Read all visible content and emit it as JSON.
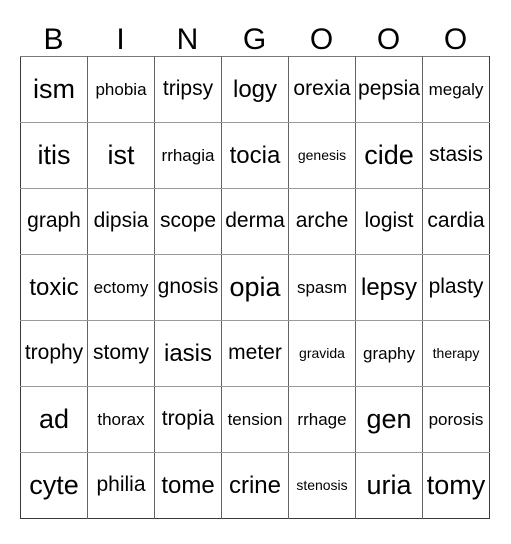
{
  "card": {
    "title_letters": [
      "B",
      "I",
      "N",
      "G",
      "O",
      "O",
      "O"
    ],
    "columns": 7,
    "rows": 7,
    "colors": {
      "background": "#ffffff",
      "text": "#000000",
      "vertical_border": "#636363",
      "horizontal_border": "#9a9a9a",
      "outer_border": "#3a3a3a"
    },
    "grid": [
      [
        {
          "text": "ism",
          "size": "sz-xl"
        },
        {
          "text": "phobia",
          "size": "sz-sm"
        },
        {
          "text": "tripsy",
          "size": "sz-md"
        },
        {
          "text": "logy",
          "size": "sz-lg"
        },
        {
          "text": "orexia",
          "size": "sz-md"
        },
        {
          "text": "pepsia",
          "size": "sz-md"
        },
        {
          "text": "megaly",
          "size": "sz-sm"
        }
      ],
      [
        {
          "text": "itis",
          "size": "sz-xl"
        },
        {
          "text": "ist",
          "size": "sz-xl"
        },
        {
          "text": "rrhagia",
          "size": "sz-sm"
        },
        {
          "text": "tocia",
          "size": "sz-lg"
        },
        {
          "text": "genesis",
          "size": "sz-xs"
        },
        {
          "text": "cide",
          "size": "sz-xl"
        },
        {
          "text": "stasis",
          "size": "sz-md"
        }
      ],
      [
        {
          "text": "graph",
          "size": "sz-md"
        },
        {
          "text": "dipsia",
          "size": "sz-md"
        },
        {
          "text": "scope",
          "size": "sz-md"
        },
        {
          "text": "derma",
          "size": "sz-md"
        },
        {
          "text": "arche",
          "size": "sz-md"
        },
        {
          "text": "logist",
          "size": "sz-md"
        },
        {
          "text": "cardia",
          "size": "sz-md"
        }
      ],
      [
        {
          "text": "toxic",
          "size": "sz-lg"
        },
        {
          "text": "ectomy",
          "size": "sz-sm"
        },
        {
          "text": "gnosis",
          "size": "sz-md"
        },
        {
          "text": "opia",
          "size": "sz-xl"
        },
        {
          "text": "spasm",
          "size": "sz-sm"
        },
        {
          "text": "lepsy",
          "size": "sz-lg"
        },
        {
          "text": "plasty",
          "size": "sz-md"
        }
      ],
      [
        {
          "text": "trophy",
          "size": "sz-md"
        },
        {
          "text": "stomy",
          "size": "sz-md"
        },
        {
          "text": "iasis",
          "size": "sz-lg"
        },
        {
          "text": "meter",
          "size": "sz-md"
        },
        {
          "text": "gravida",
          "size": "sz-xs"
        },
        {
          "text": "graphy",
          "size": "sz-sm"
        },
        {
          "text": "therapy",
          "size": "sz-xs"
        }
      ],
      [
        {
          "text": "ad",
          "size": "sz-xl"
        },
        {
          "text": "thorax",
          "size": "sz-sm"
        },
        {
          "text": "tropia",
          "size": "sz-md"
        },
        {
          "text": "tension",
          "size": "sz-sm"
        },
        {
          "text": "rrhage",
          "size": "sz-sm"
        },
        {
          "text": "gen",
          "size": "sz-xl"
        },
        {
          "text": "porosis",
          "size": "sz-sm"
        }
      ],
      [
        {
          "text": "cyte",
          "size": "sz-xl"
        },
        {
          "text": "philia",
          "size": "sz-md"
        },
        {
          "text": "tome",
          "size": "sz-lg"
        },
        {
          "text": "crine",
          "size": "sz-lg"
        },
        {
          "text": "stenosis",
          "size": "sz-xs"
        },
        {
          "text": "uria",
          "size": "sz-xl"
        },
        {
          "text": "tomy",
          "size": "sz-xl"
        }
      ]
    ]
  }
}
